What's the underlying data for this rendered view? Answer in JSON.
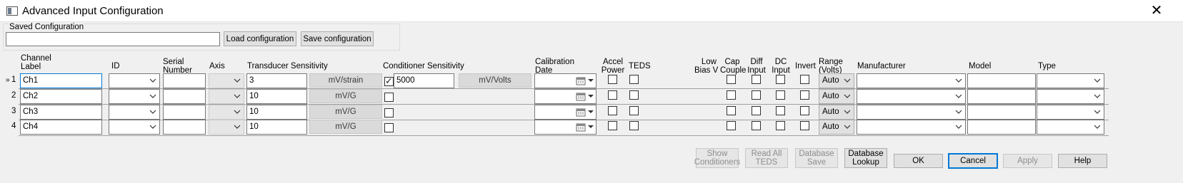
{
  "window": {
    "title": "Advanced Input Configuration",
    "close_glyph": "✕"
  },
  "saved_config": {
    "legend": "Saved Configuration",
    "path_value": "",
    "load_label": "Load configuration",
    "save_label": "Save configuration"
  },
  "columns": {
    "channel_label": [
      "Channel",
      "Label"
    ],
    "id": "ID",
    "serial_number": [
      "Serial",
      "Number"
    ],
    "axis": "Axis",
    "transducer_sensitivity": "Transducer Sensitivity",
    "conditioner_sensitivity": "Conditioner Sensitivity",
    "calibration_date": [
      "Calibration",
      "Date"
    ],
    "accel_power": [
      "Accel",
      "Power"
    ],
    "teds": "TEDS",
    "low_bias_v": [
      "Low",
      "Bias V"
    ],
    "cap_couple": [
      "Cap",
      "Couple"
    ],
    "diff_input": [
      "Diff",
      "Input"
    ],
    "dc_input": [
      "DC",
      "Input"
    ],
    "invert": "Invert",
    "range": [
      "Range",
      "(Volts)"
    ],
    "manufacturer": "Manufacturer",
    "model": "Model",
    "type": "Type"
  },
  "rows": [
    {
      "marker": "»",
      "num": "1",
      "label": "Ch1",
      "sensitivity": "3",
      "unit": "mV/strain",
      "cond_enabled": true,
      "cond_value": "5000",
      "cond_unit": "mV/Volts",
      "range": "Auto"
    },
    {
      "marker": "",
      "num": "2",
      "label": "Ch2",
      "sensitivity": "10",
      "unit": "mV/G",
      "cond_enabled": false,
      "range": "Auto"
    },
    {
      "marker": "",
      "num": "3",
      "label": "Ch3",
      "sensitivity": "10",
      "unit": "mV/G",
      "cond_enabled": false,
      "range": "Auto"
    },
    {
      "marker": "",
      "num": "4",
      "label": "Ch4",
      "sensitivity": "10",
      "unit": "mV/G",
      "cond_enabled": false,
      "range": "Auto"
    }
  ],
  "footer": {
    "show_conditioners": [
      "Show",
      "Conditioners"
    ],
    "read_all_teds": [
      "Read All",
      "TEDS"
    ],
    "database_save": [
      "Database",
      "Save"
    ],
    "database_lookup": [
      "Database",
      "Lookup"
    ],
    "ok": "OK",
    "cancel": "Cancel",
    "apply": "Apply",
    "help": "Help"
  },
  "icons": {
    "chevron": "chevron-down-icon",
    "calendar": "calendar-icon",
    "app": "window-icon"
  }
}
